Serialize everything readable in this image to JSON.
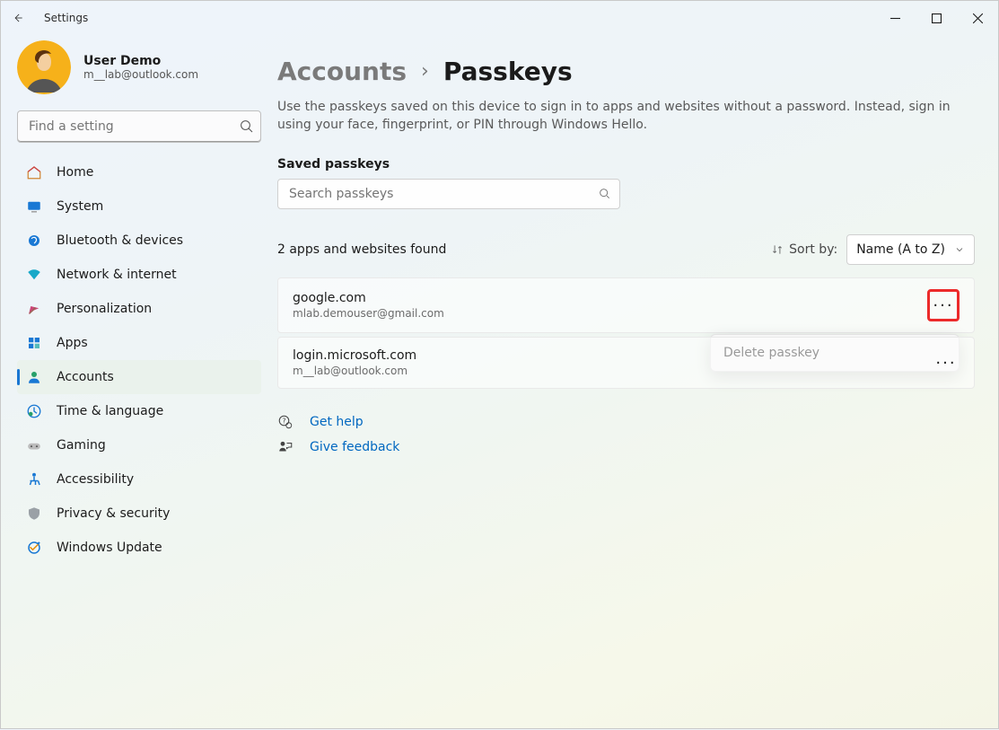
{
  "window": {
    "title": "Settings"
  },
  "user": {
    "name": "User Demo",
    "email": "m__lab@outlook.com"
  },
  "sidebar": {
    "search_placeholder": "Find a setting",
    "items": [
      {
        "label": "Home"
      },
      {
        "label": "System"
      },
      {
        "label": "Bluetooth & devices"
      },
      {
        "label": "Network & internet"
      },
      {
        "label": "Personalization"
      },
      {
        "label": "Apps"
      },
      {
        "label": "Accounts"
      },
      {
        "label": "Time & language"
      },
      {
        "label": "Gaming"
      },
      {
        "label": "Accessibility"
      },
      {
        "label": "Privacy & security"
      },
      {
        "label": "Windows Update"
      }
    ],
    "selected_index": 6
  },
  "breadcrumb": {
    "parent": "Accounts",
    "current": "Passkeys"
  },
  "description": "Use the passkeys saved on this device to sign in to apps and websites without a password. Instead, sign in using your face, fingerprint, or PIN through Windows Hello.",
  "saved_section_label": "Saved passkeys",
  "passkey_search_placeholder": "Search passkeys",
  "result_count_label": "2 apps and websites found",
  "sort": {
    "label": "Sort by:",
    "value": "Name (A to Z)"
  },
  "passkeys": [
    {
      "site": "google.com",
      "account": "mlab.demouser@gmail.com"
    },
    {
      "site": "login.microsoft.com",
      "account": "m__lab@outlook.com"
    }
  ],
  "context_menu": {
    "visible_for_index": 0,
    "items": [
      "Delete passkey"
    ]
  },
  "footer_links": {
    "help": "Get help",
    "feedback": "Give feedback"
  }
}
